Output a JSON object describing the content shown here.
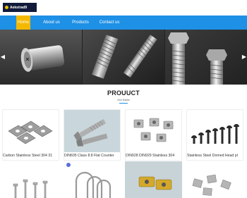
{
  "brand": {
    "logo_text": "Aekstrad9"
  },
  "nav": {
    "items": [
      {
        "label": "Home",
        "active": true
      },
      {
        "label": "About us",
        "active": false
      },
      {
        "label": "Products",
        "active": false
      },
      {
        "label": "Contact us",
        "active": false
      }
    ]
  },
  "banner": {
    "slides": [
      "flanged-pin",
      "threaded-studs",
      "hex-bolts"
    ],
    "prev_icon": "chevron-left-icon",
    "next_icon": "chevron-right-icon"
  },
  "products": {
    "title": "PROUUCT",
    "subtitle": "Hot Sales",
    "items": [
      {
        "label": "Carbon Stainless Steel 304 31"
      },
      {
        "label": "DIN605 Class 8.8 Flat Counter"
      },
      {
        "label": "DIN928 DIN929 Stainless 304"
      },
      {
        "label": "Stainless Steel Domed Head pl"
      }
    ]
  },
  "colors": {
    "nav_bg": "#1e90e6",
    "nav_active": "#f5b800",
    "logo_bg": "#111a3a"
  }
}
